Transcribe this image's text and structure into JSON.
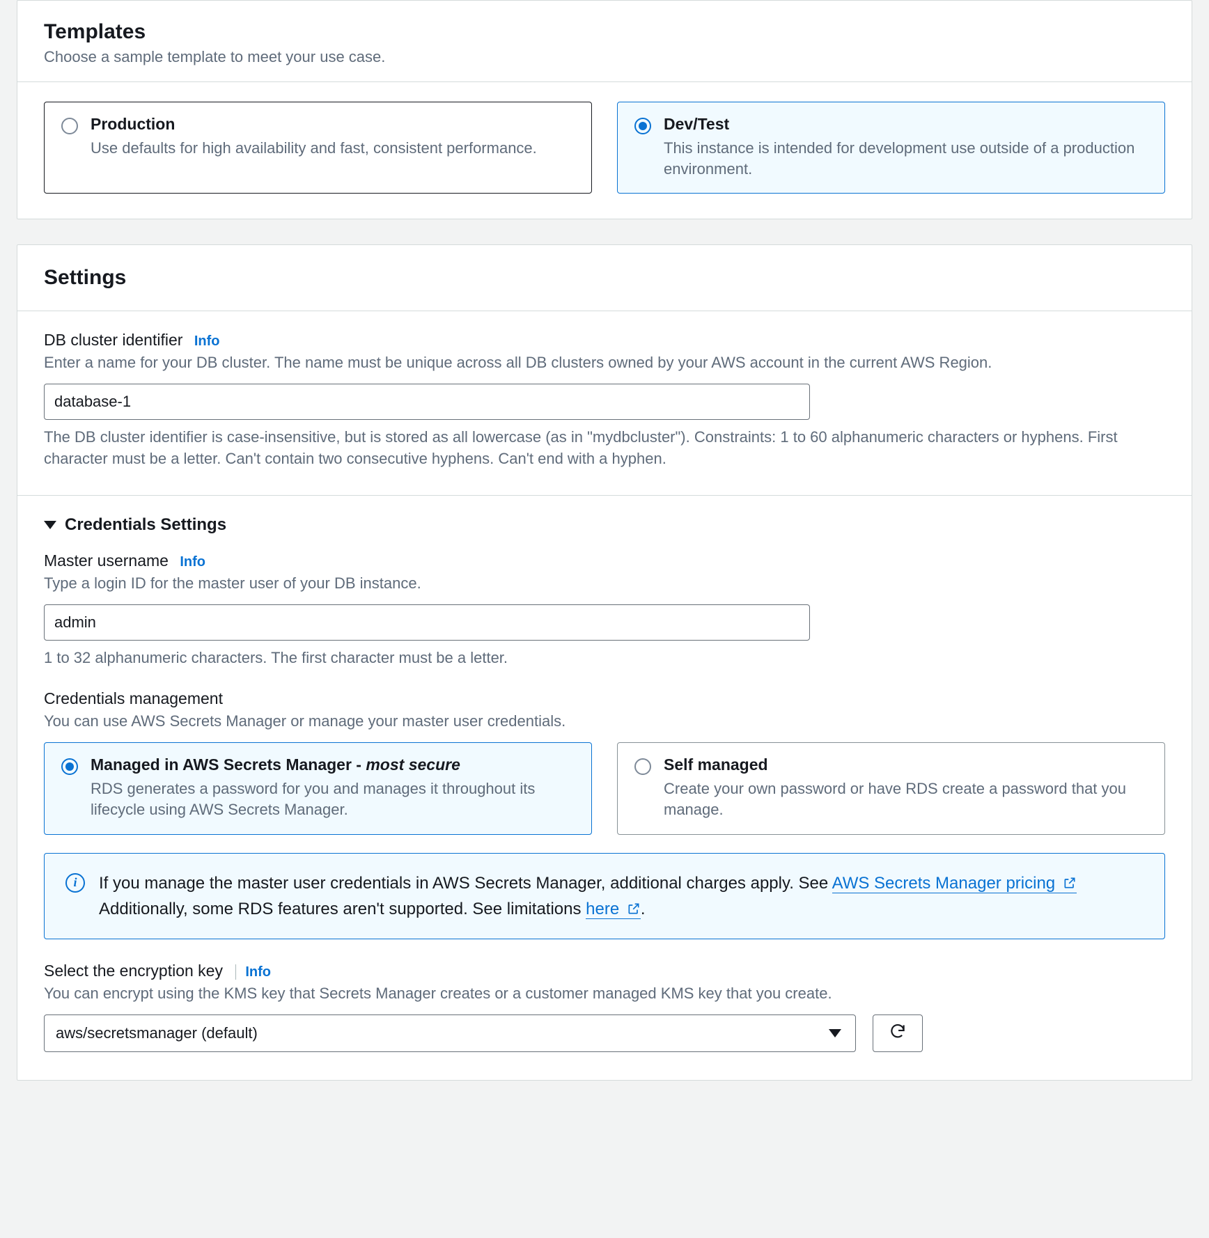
{
  "templates": {
    "title": "Templates",
    "subtitle": "Choose a sample template to meet your use case.",
    "options": [
      {
        "title": "Production",
        "description": "Use defaults for high availability and fast, consistent performance.",
        "selected": false
      },
      {
        "title": "Dev/Test",
        "description": "This instance is intended for development use outside of a production environment.",
        "selected": true
      }
    ]
  },
  "settings": {
    "title": "Settings",
    "cluster_id": {
      "label": "DB cluster identifier",
      "info": "Info",
      "help": "Enter a name for your DB cluster. The name must be unique across all DB clusters owned by your AWS account in the current AWS Region.",
      "value": "database-1",
      "constraints": "The DB cluster identifier is case-insensitive, but is stored as all lowercase (as in \"mydbcluster\"). Constraints: 1 to 60 alphanumeric characters or hyphens. First character must be a letter. Can't contain two consecutive hyphens. Can't end with a hyphen."
    },
    "credentials": {
      "section_title": "Credentials Settings",
      "username": {
        "label": "Master username",
        "info": "Info",
        "help": "Type a login ID for the master user of your DB instance.",
        "value": "admin",
        "constraints": "1 to 32 alphanumeric characters. The first character must be a letter."
      },
      "management": {
        "label": "Credentials management",
        "help": "You can use AWS Secrets Manager or manage your master user credentials.",
        "options": [
          {
            "title_prefix": "Managed in AWS Secrets Manager - ",
            "title_em": "most secure",
            "description": "RDS generates a password for you and manages it throughout its lifecycle using AWS Secrets Manager.",
            "selected": true
          },
          {
            "title": "Self managed",
            "description": "Create your own password or have RDS create a password that you manage.",
            "selected": false
          }
        ]
      },
      "alert": {
        "text_a": "If you manage the master user credentials in AWS Secrets Manager, additional charges apply. See ",
        "link_a": "AWS Secrets Manager pricing ",
        "text_b": " Additionally, some RDS features aren't supported. See limitations ",
        "link_b": "here ",
        "period": "."
      },
      "encryption": {
        "label": "Select the encryption key",
        "info": "Info",
        "help": "You can encrypt using the KMS key that Secrets Manager creates or a customer managed KMS key that you create.",
        "selected": "aws/secretsmanager (default)"
      }
    }
  }
}
